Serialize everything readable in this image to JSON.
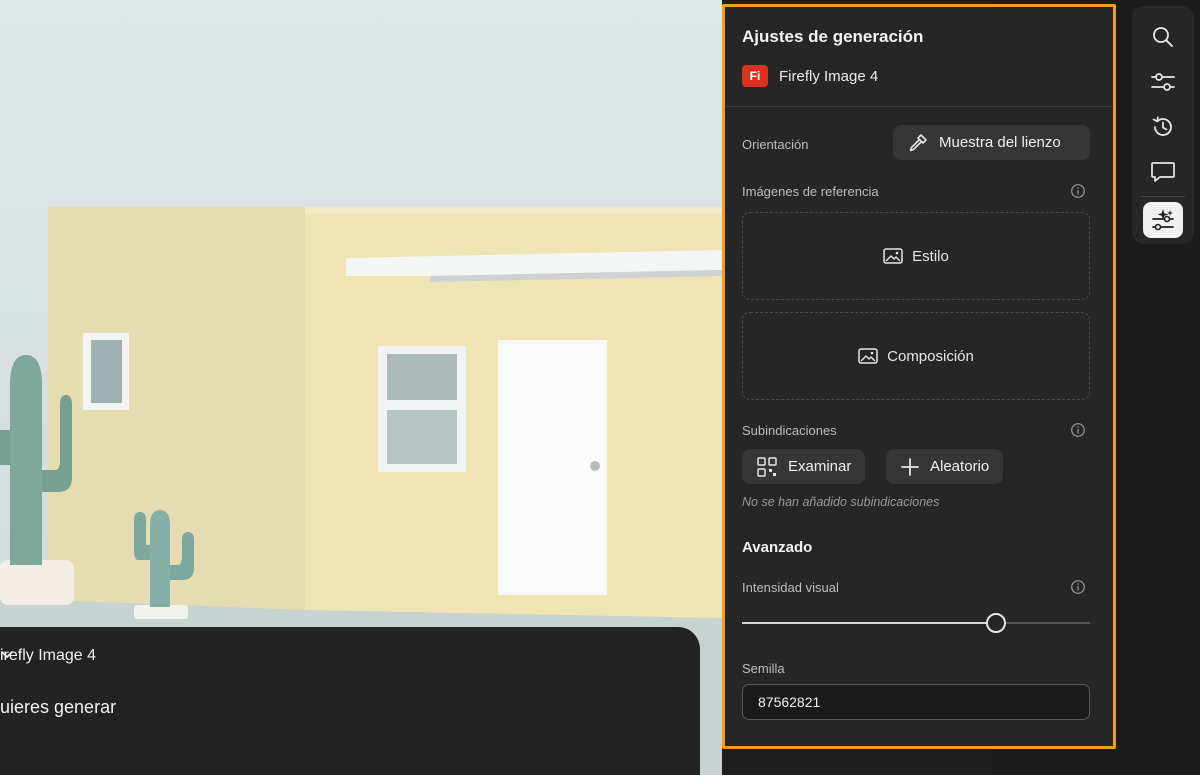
{
  "prompt": {
    "model_label": "irefly Image 4",
    "text": "uieres generar"
  },
  "panel": {
    "title": "Ajustes de generación",
    "model": {
      "badge": "Fi",
      "name": "Firefly Image 4"
    },
    "orientation": {
      "label": "Orientación",
      "button_label": "Muestra del lienzo"
    },
    "reference_images": {
      "label": "Imágenes de referencia",
      "style_label": "Estilo",
      "composition_label": "Composición"
    },
    "subprompts": {
      "label": "Subindicaciones",
      "browse_label": "Examinar",
      "random_label": "Aleatorio",
      "empty_hint": "No se han añadido subindicaciones"
    },
    "advanced": {
      "title": "Avanzado",
      "visual_intensity_label": "Intensidad visual",
      "visual_intensity_value": 0.73,
      "seed_label": "Semilla",
      "seed_value": "87562821"
    }
  },
  "toolbar": {
    "items": [
      "search-icon",
      "sliders-icon",
      "history-icon",
      "comment-icon",
      "generation-settings-icon"
    ],
    "active": "generation-settings-icon"
  },
  "colors": {
    "accent_outline": "#f59b22",
    "badge": "#d9321f",
    "panel_bg": "#262626"
  }
}
